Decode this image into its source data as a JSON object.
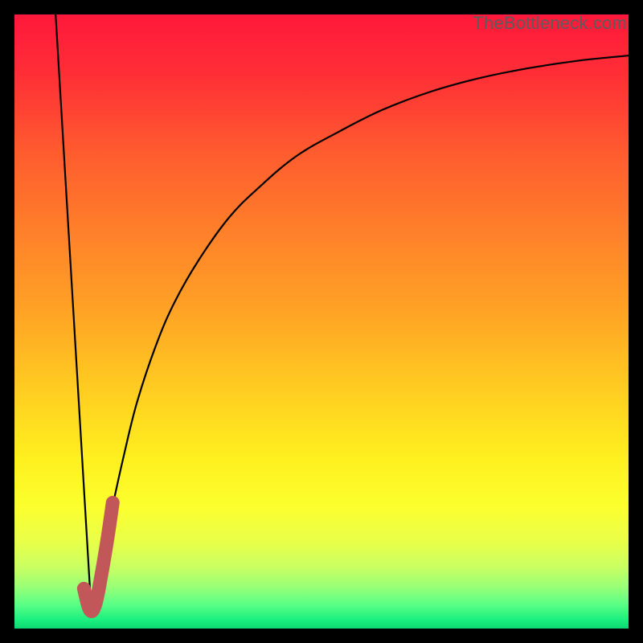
{
  "watermark": "TheBottleneck.com",
  "colors": {
    "frame": "#000000",
    "curve": "#000000",
    "marker": "#c15758",
    "gradient_stops": [
      {
        "offset": 0.0,
        "color": "#ff183b"
      },
      {
        "offset": 0.1,
        "color": "#ff2f36"
      },
      {
        "offset": 0.22,
        "color": "#ff5a2f"
      },
      {
        "offset": 0.35,
        "color": "#ff7f2a"
      },
      {
        "offset": 0.48,
        "color": "#ffa225"
      },
      {
        "offset": 0.6,
        "color": "#ffc921"
      },
      {
        "offset": 0.72,
        "color": "#ffef1f"
      },
      {
        "offset": 0.8,
        "color": "#fcff2d"
      },
      {
        "offset": 0.86,
        "color": "#e8ff4a"
      },
      {
        "offset": 0.9,
        "color": "#c9ff62"
      },
      {
        "offset": 0.93,
        "color": "#9dff76"
      },
      {
        "offset": 0.96,
        "color": "#5cff86"
      },
      {
        "offset": 0.985,
        "color": "#1cf07f"
      },
      {
        "offset": 1.0,
        "color": "#0bd872"
      }
    ]
  },
  "chart_data": {
    "type": "line",
    "title": "",
    "xlabel": "",
    "ylabel": "",
    "xlim": [
      0,
      100
    ],
    "ylim": [
      0,
      100
    ],
    "grid": false,
    "legend": false,
    "series": [
      {
        "name": "left-segment",
        "x": [
          6.7,
          12.5
        ],
        "values": [
          100,
          3
        ]
      },
      {
        "name": "right-curve",
        "x": [
          12.5,
          14,
          16,
          18,
          20,
          23,
          26,
          30,
          35,
          40,
          46,
          53,
          60,
          68,
          76,
          84,
          92,
          100
        ],
        "values": [
          3,
          10,
          20,
          29,
          37,
          46,
          53,
          60,
          67,
          72,
          77,
          81,
          84.5,
          87.5,
          89.7,
          91.3,
          92.5,
          93.3
        ]
      },
      {
        "name": "highlight-marker",
        "x": [
          11.3,
          12.3,
          13.2,
          14.2,
          15.2,
          16.0
        ],
        "values": [
          6.5,
          3.0,
          4.0,
          9.0,
          15.0,
          20.5
        ]
      }
    ]
  }
}
